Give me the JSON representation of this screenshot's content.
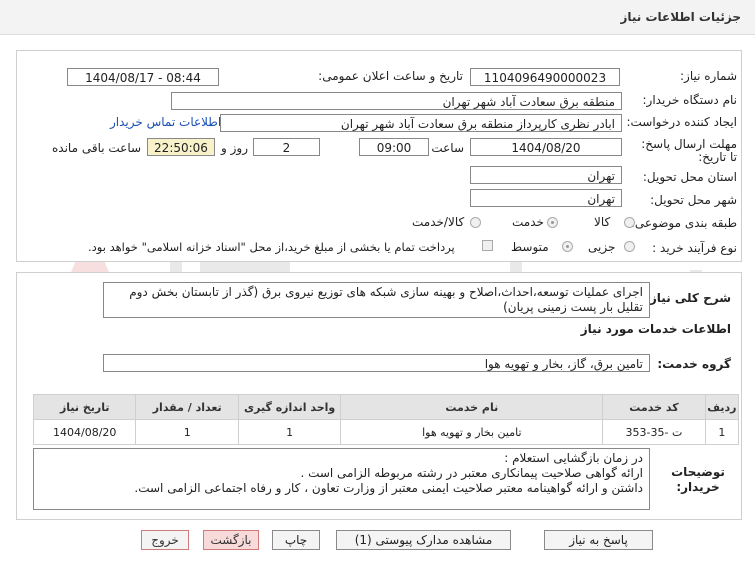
{
  "header": {
    "title": "جزئیات اطلاعات نیاز"
  },
  "form": {
    "need_number_label": "شماره نیاز:",
    "need_number": "1104096490000023",
    "announce_label": "تاریخ و ساعت اعلان عمومی:",
    "announce_value": "1404/08/17 - 08:44",
    "buyer_label": "نام دستگاه خریدار:",
    "buyer_value": "منطقه برق سعادت آباد شهر تهران",
    "creator_label": "ایجاد کننده درخواست:",
    "creator_value": "ابادر نظری کارپرداز منطقه برق سعادت آباد شهر تهران",
    "contact_link": "اطلاعات تماس خریدار",
    "deadline_label": "مهلت ارسال پاسخ: تا تاریخ:",
    "deadline_date": "1404/08/20",
    "hour_label": "ساعت",
    "deadline_time": "09:00",
    "days_value": "2",
    "days_label": "روز و",
    "remaining_time": "22:50:06",
    "remaining_label": "ساعت باقی مانده",
    "province_label": "استان محل تحویل:",
    "province_value": "تهران",
    "city_label": "شهر محل تحویل:",
    "city_value": "تهران",
    "category_label": "طبقه بندی موضوعی:",
    "category_options": [
      "کالا",
      "خدمت",
      "کالا/خدمت"
    ],
    "category_selected": "خدمت",
    "process_label": "نوع فرآیند خرید :",
    "process_options": [
      "جزیی",
      "متوسط"
    ],
    "process_selected": "متوسط",
    "payment_note": "پرداخت تمام یا بخشی از مبلغ خرید،از محل \"اسناد خزانه اسلامی\" خواهد بود."
  },
  "details": {
    "summary_label": "شرح کلی نیاز:",
    "summary_text": "اجرای عملیات توسعه،احداث،اصلاح و بهینه سازی شبکه های توزیع نیروی برق (گذر از تابستان بخش دوم تقلیل بار پست زمینی پریان)",
    "services_heading": "اطلاعات خدمات مورد نیاز",
    "service_group_label": "گروه خدمت:",
    "service_group_value": "تامین برق، گاز، بخار و تهویه هوا",
    "table": {
      "headers": [
        "ردیف",
        "کد خدمت",
        "نام خدمت",
        "واحد اندازه گیری",
        "تعداد / مقدار",
        "تاریخ نیاز"
      ],
      "rows": [
        [
          "1",
          "ت -35-353",
          "تامین بخار و تهویه هوا",
          "1",
          "1",
          "1404/08/20"
        ]
      ]
    },
    "buyer_notes_label": "توضیحات خریدار:",
    "buyer_notes": [
      "در زمان بازگشایی استعلام :",
      "ارائه گواهی صلاحیت پیمانکاری معتبر در رشته مربوطه الزامی است .",
      "داشتن و ارائه گواهینامه معتبر صلاحیت ایمنی معتبر از وزارت تعاون ، کار و رفاه اجتماعی الزامی است."
    ]
  },
  "actions": {
    "reply": "پاسخ به نیاز",
    "attachments": "مشاهده مدارک پیوستی (1)",
    "print": "چاپ",
    "back": "بازگشت",
    "exit": "خروج"
  },
  "colors": {
    "link": "#1a4fb5",
    "highlight": "#f7f2c9",
    "back_button": "#f8dada"
  }
}
